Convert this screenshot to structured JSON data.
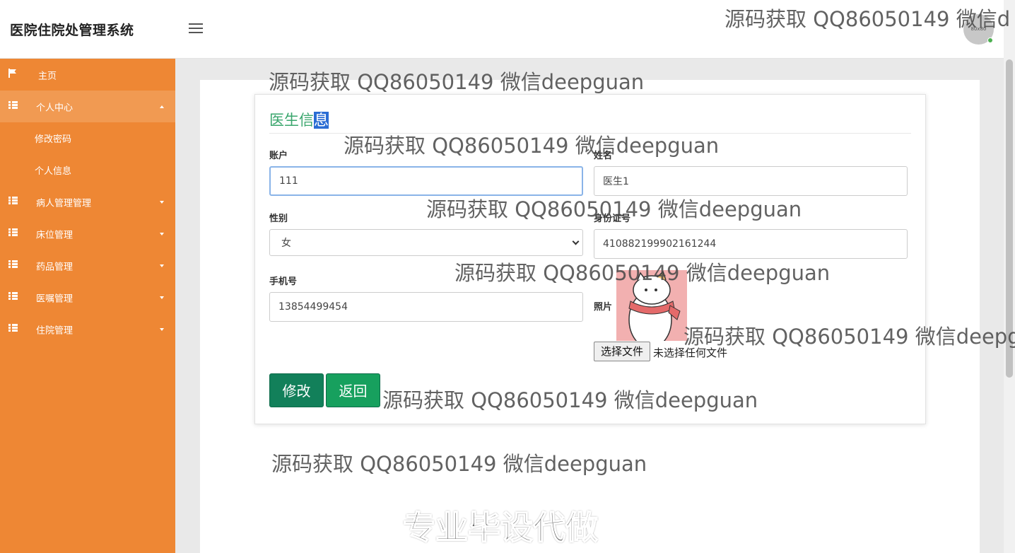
{
  "app": {
    "title": "医院住院处管理系统",
    "avatar_text": "80x80"
  },
  "sidebar": {
    "items": [
      {
        "label": "主页",
        "icon": "flag-icon"
      },
      {
        "label": "个人中心",
        "icon": "grid-icon",
        "expanded": true,
        "children": [
          {
            "label": "修改密码"
          },
          {
            "label": "个人信息"
          }
        ]
      },
      {
        "label": "病人管理管理",
        "icon": "grid-icon"
      },
      {
        "label": "床位管理",
        "icon": "grid-icon"
      },
      {
        "label": "药品管理",
        "icon": "grid-icon"
      },
      {
        "label": "医嘱管理",
        "icon": "grid-icon"
      },
      {
        "label": "住院管理",
        "icon": "grid-icon"
      }
    ]
  },
  "form": {
    "title_a": "医生",
    "title_b": "信",
    "title_c": "息",
    "account_label": "账户",
    "account_value": "111",
    "name_label": "姓名",
    "name_value": "医生1",
    "gender_label": "性别",
    "gender_value": "女",
    "id_label": "身份证号",
    "id_value": "410882199902161244",
    "phone_label": "手机号",
    "phone_value": "13854499454",
    "photo_label": "照片",
    "file_button": "选择文件",
    "file_status": "未选择任何文件",
    "submit_label": "修改",
    "back_label": "返回"
  },
  "watermarks": {
    "w1": "源码获取 QQ86050149 微信deepguan",
    "w_top": "源码获取 QQ86050149 微信d",
    "w_right": "源码获取 QQ86050149 微信deepg",
    "slogan": "专业毕设代做"
  },
  "colors": {
    "sidebar": "#ee8734",
    "accent_green": "#12805a",
    "title_green": "#3aa66d"
  }
}
